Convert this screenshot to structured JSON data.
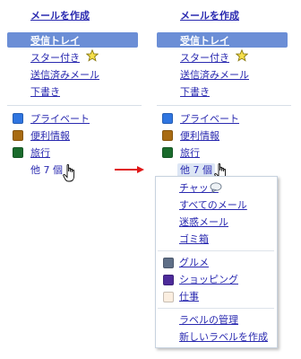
{
  "compose": "メールを作成",
  "system_folders": [
    {
      "label": "受信トレイ"
    },
    {
      "label": "スター付き",
      "icon": "star-icon"
    },
    {
      "label": "送信済みメール"
    },
    {
      "label": "下書き"
    }
  ],
  "labels_collapsed": [
    {
      "label": "プライベート",
      "color": "#2f75e0"
    },
    {
      "label": "便利情報",
      "color": "#a86b12"
    },
    {
      "label": "旅行",
      "color": "#1a6b2c"
    }
  ],
  "more_link": "他 7 個",
  "dropdown": {
    "system": [
      "チャット",
      "すべてのメール",
      "迷惑メール",
      "ゴミ箱"
    ],
    "labels": [
      {
        "label": "グルメ",
        "color": "#5f6f87"
      },
      {
        "label": "ショッピング",
        "color": "#4d2b9a"
      },
      {
        "label": "仕事",
        "color": "#fbeee0"
      }
    ],
    "actions": [
      "ラベルの管理",
      "新しいラベルを作成"
    ]
  },
  "colors": {
    "link": "#2a2ab0",
    "inbox_bg": "#6b8ed6",
    "arrow": "#e01818"
  }
}
